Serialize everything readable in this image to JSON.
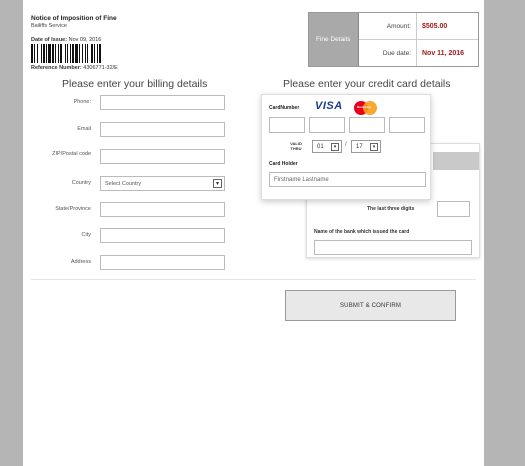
{
  "header": {
    "title": "Notice of Imposition of Fine",
    "subtitle": "Bailiffs Service",
    "issue_label": "Date of Issue:",
    "issue_value": "Nov 09, 2016",
    "ref_label": "Reference Number:",
    "ref_value": "4306771-32/E"
  },
  "fine": {
    "label": "Fine Details",
    "amount_label": "Amount:",
    "amount_value": "$505.00",
    "due_label": "Due date:",
    "due_value": "Nov 11, 2016",
    "accent_color": "#a01c1c"
  },
  "billing": {
    "heading": "Please enter your billing details",
    "phone_label": "Phone:",
    "email_label": "Email",
    "zip_label": "ZIP/Postal code",
    "country_label": "Country",
    "country_value": "Select Country",
    "state_label": "State/Province",
    "city_label": "City",
    "address_label": "Address"
  },
  "card": {
    "heading": "Please enter your credit card details",
    "number_label": "CardNumber",
    "visa_text": "VISA",
    "mc_text": "MasterCard",
    "valid_label": "VALID THRU",
    "month_value": "01",
    "year_value": "17",
    "separator": "/",
    "holder_label": "Card Holder",
    "holder_placeholder": "Firstname Lastname",
    "cvv_label": "The last three digits",
    "bank_label": "Name of the bank which issued the card"
  },
  "actions": {
    "submit_label": "SUBMIT & CONFIRM"
  }
}
